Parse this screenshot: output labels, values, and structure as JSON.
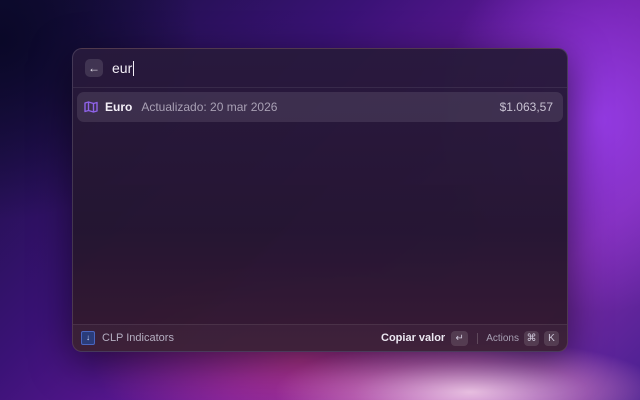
{
  "search": {
    "query": "eur",
    "back_icon": "arrow-left-icon"
  },
  "results": [
    {
      "icon": "map-icon",
      "icon_color": "#8e62e8",
      "title": "Euro",
      "subtitle": "Actualizado: 20 mar 2026",
      "value": "$1.063,57"
    }
  ],
  "footer": {
    "extension_icon": "indicator-icon",
    "extension_name": "CLP Indicators",
    "primary_action": "Copiar valor",
    "enter_key": "↵",
    "actions_label": "Actions",
    "cmd_key": "⌘",
    "k_key": "K"
  }
}
